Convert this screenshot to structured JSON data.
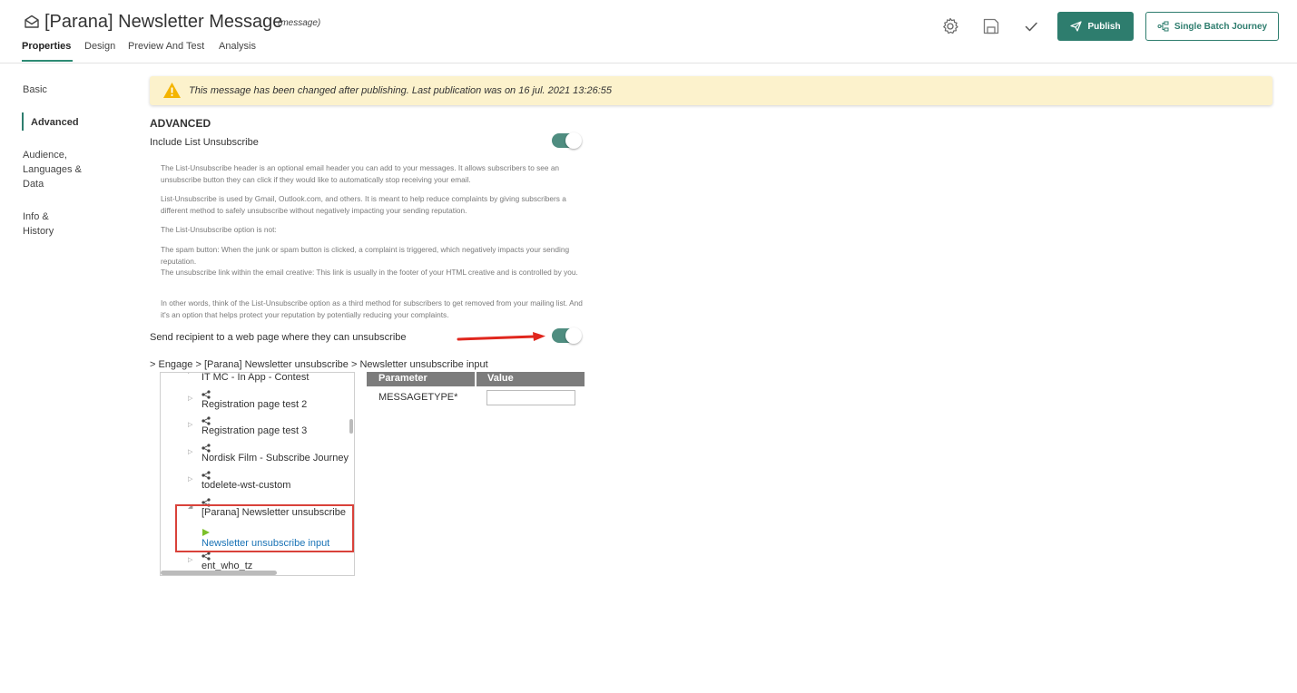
{
  "header": {
    "title": "[Parana] Newsletter Message",
    "subtitle": "(message)",
    "tabs": [
      "Properties",
      "Design",
      "Preview And Test",
      "Analysis"
    ],
    "active_tab": "Properties",
    "publish_label": "Publish",
    "single_batch_label": "Single Batch Journey"
  },
  "sidebar": {
    "items": [
      "Basic",
      "Advanced",
      "Audience, Languages & Data",
      "Info & History"
    ],
    "active": "Advanced"
  },
  "alert": {
    "text": "This message has been changed after publishing. Last publication was on 16 jul. 2021 13:26:55"
  },
  "advanced": {
    "heading": "ADVANCED",
    "include_unsubscribe_label": "Include List Unsubscribe",
    "include_unsubscribe_on": true,
    "description": [
      "The List-Unsubscribe header is an optional email header you can add to your messages. It allows subscribers to see an unsubscribe button they can click if they would like to automatically stop receiving your email.",
      "List-Unsubscribe is used by Gmail, Outlook.com, and others. It is meant to help reduce complaints by giving subscribers a different method to safely unsubscribe without negatively impacting your sending reputation.",
      "The List-Unsubscribe option is not:",
      "The spam button: When the junk or spam button is clicked, a complaint is triggered, which negatively impacts your sending reputation.",
      "The unsubscribe link within the email creative: This link is usually in the footer of your HTML creative and is controlled by you.",
      "In other words, think of the List-Unsubscribe option as a third method for subscribers to get removed from your mailing list. And it's an option that helps protect your reputation by potentially reducing your complaints."
    ],
    "web_page_label": "Send recipient to a web page where they can unsubscribe",
    "web_page_on": true,
    "breadcrumb": "> Engage > [Parana] Newsletter unsubscribe > Newsletter unsubscribe input"
  },
  "tree": {
    "items": [
      "IT MC - In App - Contest",
      "Registration page test 2",
      "Registration page test 3",
      "Nordisk Film - Subscribe Journey",
      "todelete-wst-custom",
      "[Parana] Newsletter unsubscribe",
      "ent_who_tz"
    ],
    "selected_child": "Newsletter unsubscribe input"
  },
  "parameters": {
    "col_parameter": "Parameter",
    "col_value": "Value",
    "rows": [
      {
        "name": "MESSAGETYPE*",
        "value": ""
      }
    ]
  },
  "colors": {
    "accent": "#2e7d6e",
    "alert_bg": "#fcf2cc",
    "highlight": "#d9423a",
    "link": "#1a73b6"
  }
}
